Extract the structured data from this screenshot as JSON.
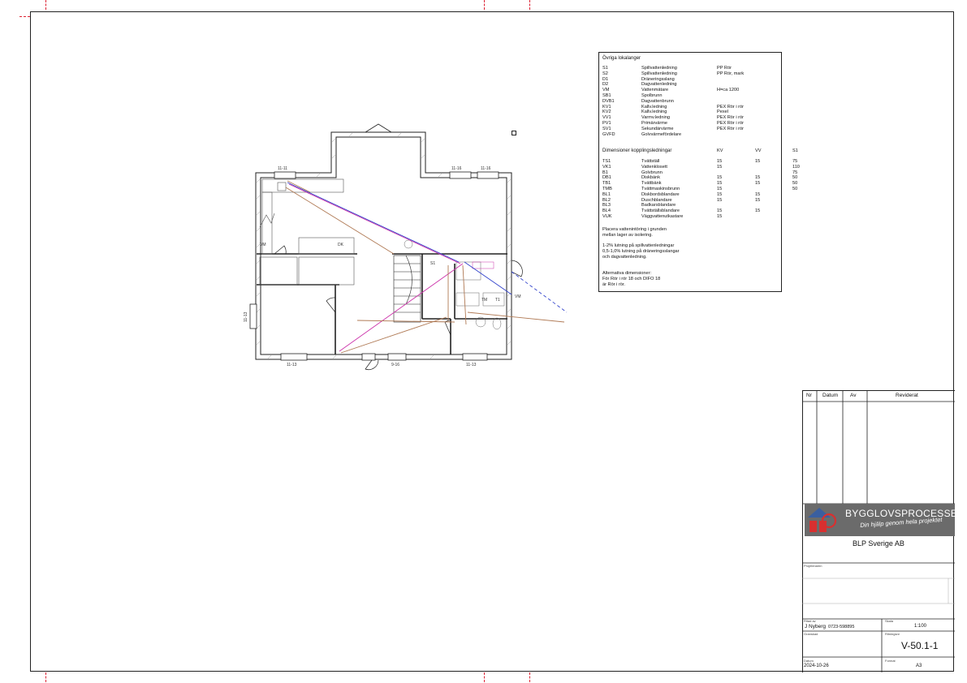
{
  "legend": {
    "section1_title": "Övriga lokalanger",
    "section1_rows": [
      {
        "code": "S1",
        "name": "Spillvattenledning",
        "material": "PP Rör"
      },
      {
        "code": "S2",
        "name": "Spillvattenledning",
        "material": "PP Rör, mark"
      },
      {
        "code": "D1",
        "name": "Dräneringsslang",
        "material": ""
      },
      {
        "code": "D2",
        "name": "Dagvattenledning",
        "material": ""
      },
      {
        "code": "VM",
        "name": "Vattenmätare",
        "material": "H=ca 1200"
      },
      {
        "code": "SB1",
        "name": "Spolbrunn",
        "material": ""
      },
      {
        "code": "DVB1",
        "name": "Dagvattenbrunn",
        "material": ""
      },
      {
        "code": "KV1",
        "name": "Kallv.ledning",
        "material": "PEX Rör i rör"
      },
      {
        "code": "KV2",
        "name": "Kallv.ledning",
        "material": "Pexel"
      },
      {
        "code": "VV1",
        "name": "Varmv.ledning",
        "material": "PEX Rör i rör"
      },
      {
        "code": "PV1",
        "name": "Primärvärme",
        "material": "PEX Rör i rör"
      },
      {
        "code": "SV1",
        "name": "Sekundärvärme",
        "material": "PEX Rör i rör"
      },
      {
        "code": "GVFD",
        "name": "Golvvärmefördelare",
        "material": ""
      }
    ],
    "section2_title": "Dimensioner kopplingsledningar",
    "section2_headers": [
      "KV",
      "VV",
      "S1"
    ],
    "section2_rows": [
      {
        "code": "TS1",
        "name": "Tvättställ",
        "kv": "15",
        "vv": "15",
        "s1": "75"
      },
      {
        "code": "VK1",
        "name": "Vattenklosett",
        "kv": "15",
        "vv": "",
        "s1": "110"
      },
      {
        "code": "B1",
        "name": "Golvbrunn",
        "kv": "",
        "vv": "",
        "s1": "75"
      },
      {
        "code": "DB1",
        "name": "Diskbänk",
        "kv": "15",
        "vv": "15",
        "s1": "50"
      },
      {
        "code": "TB1",
        "name": "Tvättbänk",
        "kv": "15",
        "vv": "15",
        "s1": "50"
      },
      {
        "code": "TMB",
        "name": "Tvättmaskinsbrunn",
        "kv": "15",
        "vv": "",
        "s1": "50"
      },
      {
        "code": "BL1",
        "name": "Diskbordsblandare",
        "kv": "15",
        "vv": "15",
        "s1": ""
      },
      {
        "code": "BL2",
        "name": "Duschblandare",
        "kv": "15",
        "vv": "15",
        "s1": ""
      },
      {
        "code": "BL3",
        "name": "Badkarsblandare",
        "kv": "",
        "vv": "",
        "s1": ""
      },
      {
        "code": "BL4",
        "name": "Tvättställsblandare",
        "kv": "15",
        "vv": "15",
        "s1": ""
      },
      {
        "code": "VUK",
        "name": "Väggvattenutkastare",
        "kv": "15",
        "vv": "",
        "s1": ""
      }
    ],
    "notes": [
      "Placera vattenintöring i grunden",
      "mellan lager av isolering.",
      "",
      "1-2% lutning på spillvattenledningar",
      "0,5-1,0% lutning på dräneringsslangar",
      "och dagvattenledning.",
      "",
      "",
      "Alternativa dimensioner:",
      "För Rör i rör 18 och DIFO 18",
      "är Rör i rör."
    ]
  },
  "plan": {
    "window_labels": [
      "11-11",
      "11-16",
      "11-16",
      "11-13",
      "11-13",
      "9-16",
      "11-13"
    ],
    "room_labels": [
      "S1",
      "TM",
      "T1",
      "VM",
      "DK",
      "VM"
    ],
    "colors": {
      "wall": "#222222",
      "brown": "#b07a55",
      "blue": "#3344cc",
      "magenta": "#cc33aa",
      "red": "#cc2222"
    }
  },
  "titleblock": {
    "headers": [
      "Nr",
      "Datum",
      "Av",
      "Reviderat"
    ],
    "company_logo": "BYGGLOVSPROCESSEN",
    "logo_tagline": "Din hjälp genom hela projektet",
    "company": "BLP Sverige AB",
    "field_projektnamn": "Projektnamn",
    "field_ritad_av_label": "Ritad av",
    "drawn_by": "J Nyberg",
    "phone": "0723-598895",
    "field_skala_label": "Skala",
    "scale": "1:100",
    "field_ritningsnr_label": "Ritningsnr",
    "drawing_no": "V-50.1-1",
    "field_datum_label": "Datum",
    "date": "2024-10-26",
    "field_format_label": "Format",
    "format": "A3",
    "field_granskad_label": "Granskad"
  }
}
